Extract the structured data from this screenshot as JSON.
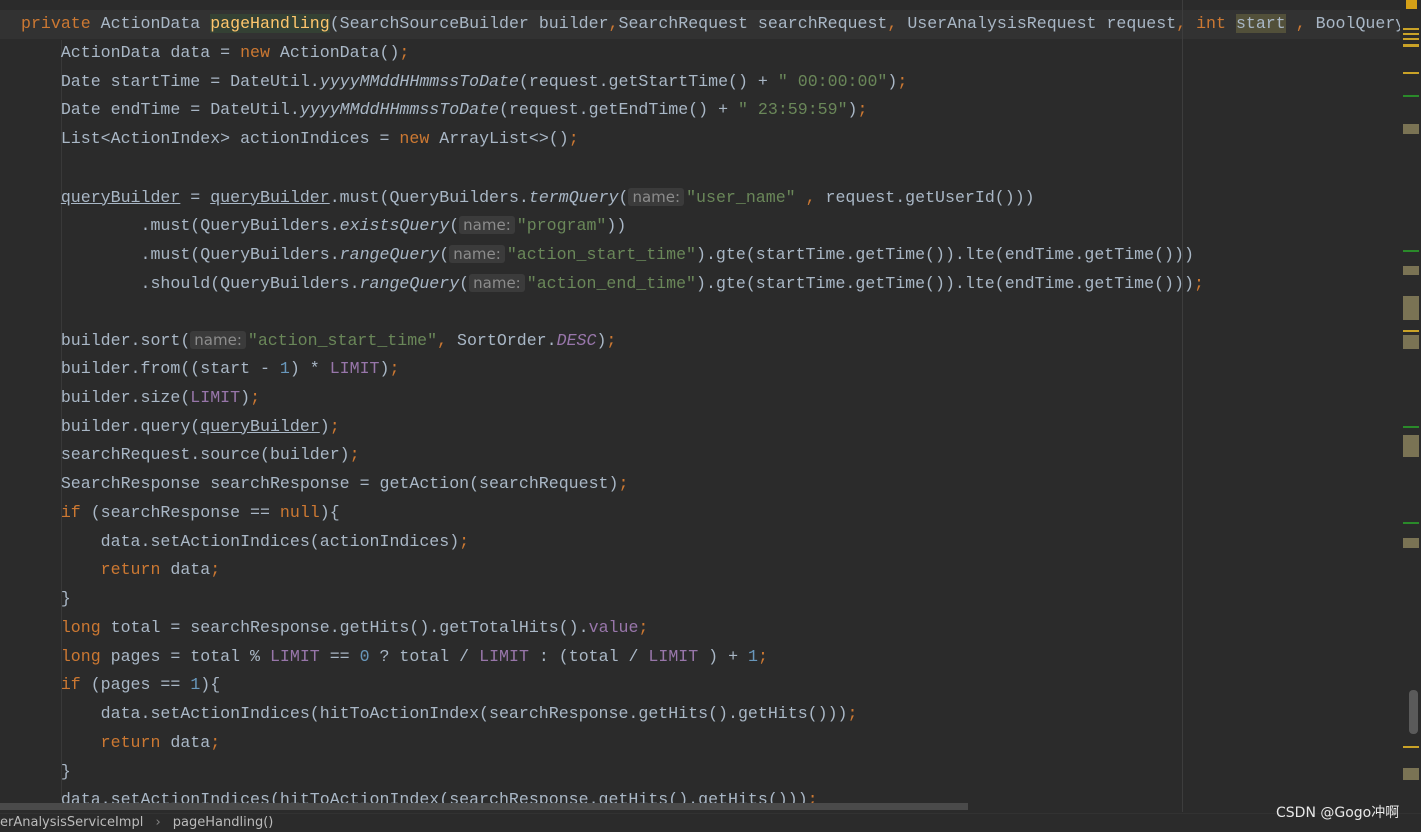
{
  "code_lines": [
    [
      [
        "k",
        "private "
      ],
      [
        "p",
        "ActionData "
      ],
      [
        "m",
        "pageHandling"
      ],
      [
        "p",
        "(SearchSourceBuilder builder"
      ],
      [
        "k",
        ","
      ],
      [
        "p",
        "SearchRequest searchRequest"
      ],
      [
        "k",
        ", "
      ],
      [
        "p",
        "UserAnalysisRequest request"
      ],
      [
        "k",
        ", int "
      ],
      [
        "sel",
        "start"
      ],
      [
        "k",
        " , "
      ],
      [
        "p",
        "BoolQueryB"
      ]
    ],
    [
      [
        "p",
        "    ActionData data = "
      ],
      [
        "k",
        "new "
      ],
      [
        "p",
        "ActionData()"
      ],
      [
        "k",
        ";"
      ]
    ],
    [
      [
        "p",
        "    Date startTime = DateUtil."
      ],
      [
        "i",
        "yyyyMMddHHmmssToDate"
      ],
      [
        "p",
        "(request.getStartTime() + "
      ],
      [
        "s",
        "\" 00:00:00\""
      ],
      [
        "p",
        ")"
      ],
      [
        "k",
        ";"
      ]
    ],
    [
      [
        "p",
        "    Date endTime = DateUtil."
      ],
      [
        "i",
        "yyyyMMddHHmmssToDate"
      ],
      [
        "p",
        "(request.getEndTime() + "
      ],
      [
        "s",
        "\" 23:59:59\""
      ],
      [
        "p",
        ")"
      ],
      [
        "k",
        ";"
      ]
    ],
    [
      [
        "p",
        "    List<ActionIndex> actionIndices = "
      ],
      [
        "k",
        "new "
      ],
      [
        "p",
        "ArrayList<>()"
      ],
      [
        "k",
        ";"
      ]
    ],
    [],
    [
      [
        "p",
        "    "
      ],
      [
        "u",
        "queryBuilder"
      ],
      [
        "p",
        " = "
      ],
      [
        "u",
        "queryBuilder"
      ],
      [
        "p",
        ".must(QueryBuilders."
      ],
      [
        "i",
        "termQuery"
      ],
      [
        "p",
        "("
      ],
      [
        "h",
        "name:"
      ],
      [
        "s",
        "\"user_name\""
      ],
      [
        "k",
        " , "
      ],
      [
        "p",
        "request.getUserId()))"
      ]
    ],
    [
      [
        "p",
        "            .must(QueryBuilders."
      ],
      [
        "i",
        "existsQuery"
      ],
      [
        "p",
        "("
      ],
      [
        "h",
        "name:"
      ],
      [
        "s",
        "\"program\""
      ],
      [
        "p",
        "))"
      ]
    ],
    [
      [
        "p",
        "            .must(QueryBuilders."
      ],
      [
        "i",
        "rangeQuery"
      ],
      [
        "p",
        "("
      ],
      [
        "h",
        "name:"
      ],
      [
        "s",
        "\"action_start_time\""
      ],
      [
        "p",
        ").gte(startTime.getTime()).lte(endTime.getTime()))"
      ]
    ],
    [
      [
        "p",
        "            .should(QueryBuilders."
      ],
      [
        "i",
        "rangeQuery"
      ],
      [
        "p",
        "("
      ],
      [
        "h",
        "name:"
      ],
      [
        "s",
        "\"action_end_time\""
      ],
      [
        "p",
        ").gte(startTime.getTime()).lte(endTime.getTime()))"
      ],
      [
        "k",
        ";"
      ]
    ],
    [],
    [
      [
        "p",
        "    builder.sort("
      ],
      [
        "h",
        "name:"
      ],
      [
        "s",
        "\"action_start_time\""
      ],
      [
        "k",
        ", "
      ],
      [
        "p",
        "SortOrder."
      ],
      [
        "ci",
        "DESC"
      ],
      [
        "p",
        ")"
      ],
      [
        "k",
        ";"
      ]
    ],
    [
      [
        "p",
        "    builder.from((start - "
      ],
      [
        "n",
        "1"
      ],
      [
        "p",
        ") * "
      ],
      [
        "c",
        "LIMIT"
      ],
      [
        "p",
        ")"
      ],
      [
        "k",
        ";"
      ]
    ],
    [
      [
        "p",
        "    builder.size("
      ],
      [
        "c",
        "LIMIT"
      ],
      [
        "p",
        ")"
      ],
      [
        "k",
        ";"
      ]
    ],
    [
      [
        "p",
        "    builder.query("
      ],
      [
        "u",
        "queryBuilder"
      ],
      [
        "p",
        ")"
      ],
      [
        "k",
        ";"
      ]
    ],
    [
      [
        "p",
        "    searchRequest.source(builder)"
      ],
      [
        "k",
        ";"
      ]
    ],
    [
      [
        "p",
        "    SearchResponse searchResponse = getAction(searchRequest)"
      ],
      [
        "k",
        ";"
      ]
    ],
    [
      [
        "k",
        "    if "
      ],
      [
        "p",
        "(searchResponse == "
      ],
      [
        "k",
        "null"
      ],
      [
        "p",
        "){"
      ]
    ],
    [
      [
        "p",
        "        data.setActionIndices(actionIndices)"
      ],
      [
        "k",
        ";"
      ]
    ],
    [
      [
        "k",
        "        return "
      ],
      [
        "p",
        "data"
      ],
      [
        "k",
        ";"
      ]
    ],
    [
      [
        "p",
        "    }"
      ]
    ],
    [
      [
        "k",
        "    long "
      ],
      [
        "p",
        "total = searchResponse.getHits().getTotalHits()."
      ],
      [
        "c",
        "value"
      ],
      [
        "k",
        ";"
      ]
    ],
    [
      [
        "k",
        "    long "
      ],
      [
        "p",
        "pages = total % "
      ],
      [
        "c",
        "LIMIT"
      ],
      [
        "p",
        " == "
      ],
      [
        "n",
        "0"
      ],
      [
        "p",
        " ? total / "
      ],
      [
        "c",
        "LIMIT"
      ],
      [
        "p",
        " : (total / "
      ],
      [
        "c",
        "LIMIT"
      ],
      [
        "p",
        " ) + "
      ],
      [
        "n",
        "1"
      ],
      [
        "k",
        ";"
      ]
    ],
    [
      [
        "k",
        "    if "
      ],
      [
        "p",
        "(pages == "
      ],
      [
        "n",
        "1"
      ],
      [
        "p",
        "){"
      ]
    ],
    [
      [
        "p",
        "        data.setActionIndices(hitToActionIndex(searchResponse.getHits().getHits()))"
      ],
      [
        "k",
        ";"
      ]
    ],
    [
      [
        "k",
        "        return "
      ],
      [
        "p",
        "data"
      ],
      [
        "k",
        ";"
      ]
    ],
    [
      [
        "p",
        "    }"
      ]
    ],
    [
      [
        "p",
        "    data.setActionIndices(hitToActionIndex(searchResponse.getHits().getHits()))"
      ],
      [
        "k",
        ";"
      ]
    ]
  ],
  "breadcrumb": {
    "class_name": "erAnalysisServiceImpl",
    "separator": "›",
    "method_name": "pageHandling()"
  },
  "watermark": "CSDN @Gogo冲啊",
  "colors": {
    "background": "#2b2b2b",
    "keyword": "#cc7832",
    "string": "#6a8759",
    "text": "#a9b7c6",
    "constant": "#9876aa",
    "number": "#6897bb",
    "method_declaration": "#ffc66d"
  }
}
